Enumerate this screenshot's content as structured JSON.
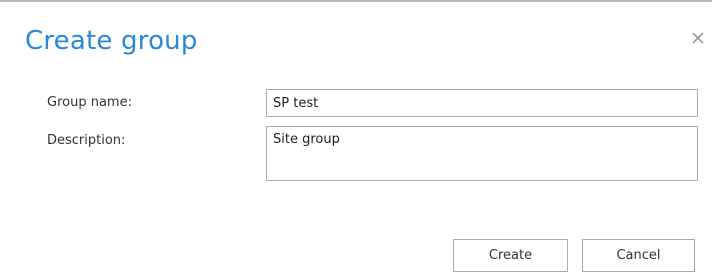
{
  "dialog": {
    "title": "Create group",
    "close_icon": "close-icon"
  },
  "form": {
    "group_name": {
      "label": "Group name:",
      "value": "SP test"
    },
    "description": {
      "label": "Description:",
      "value": "Site group"
    }
  },
  "buttons": {
    "create_label": "Create",
    "cancel_label": "Cancel"
  },
  "colors": {
    "title": "#2b88d8",
    "border": "#ababab"
  }
}
